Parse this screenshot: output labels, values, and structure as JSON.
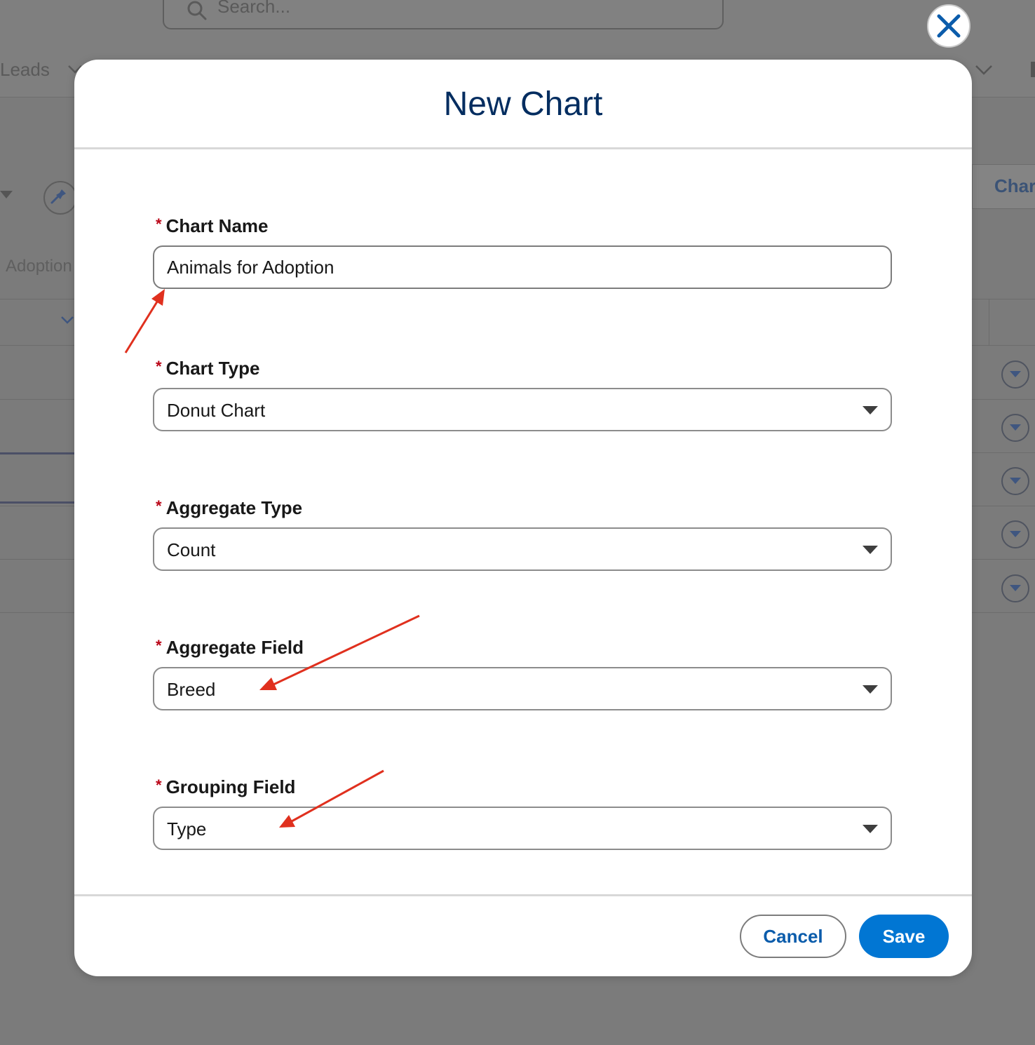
{
  "background": {
    "search_placeholder": "Search...",
    "nav_item": "Leads",
    "list_label": "Adoption",
    "right_tab": "Char"
  },
  "modal": {
    "title": "New Chart",
    "fields": [
      {
        "label": "Chart Name",
        "required_mark": "*",
        "value": "Animals for Adoption",
        "kind": "text"
      },
      {
        "label": "Chart Type",
        "required_mark": "*",
        "value": "Donut Chart",
        "kind": "select"
      },
      {
        "label": "Aggregate Type",
        "required_mark": "*",
        "value": "Count",
        "kind": "select"
      },
      {
        "label": "Aggregate Field",
        "required_mark": "*",
        "value": "Breed",
        "kind": "select"
      },
      {
        "label": "Grouping Field",
        "required_mark": "*",
        "value": "Type",
        "kind": "select"
      }
    ],
    "buttons": {
      "cancel": "Cancel",
      "save": "Save"
    }
  },
  "colors": {
    "title": "#032d60",
    "required": "#ba0517",
    "brand": "#0176d3",
    "link": "#0b5cab",
    "annotation_arrow": "#e0301e"
  },
  "icons": {
    "close": "close-x-icon",
    "select_caret": "caret-down-icon",
    "search": "search-icon",
    "pin": "pin-icon"
  }
}
